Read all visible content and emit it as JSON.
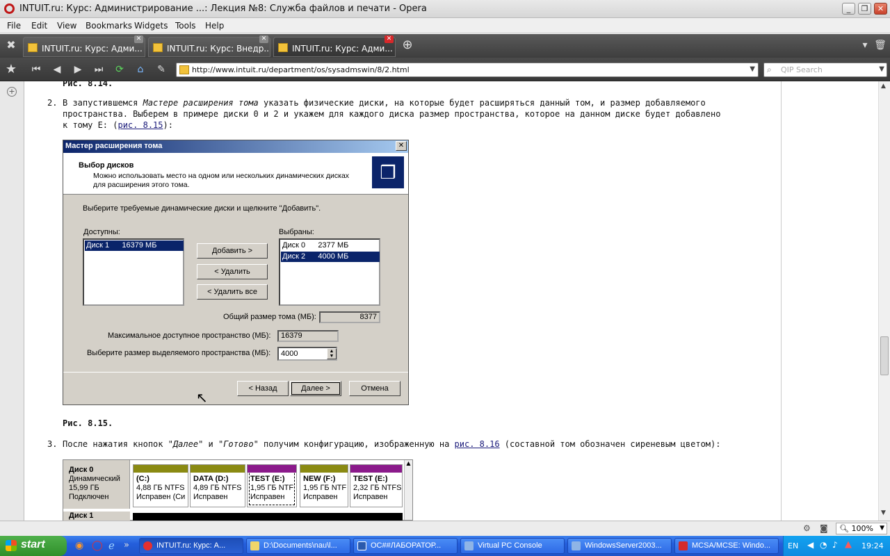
{
  "window": {
    "title": "INTUIT.ru: Курс: Администрирование ...: Лекция №8: Служба файлов и печати - Opera"
  },
  "menubar": [
    "File",
    "Edit",
    "View",
    "Bookmarks",
    "Widgets",
    "Tools",
    "Help"
  ],
  "tabs": [
    {
      "label": "INTUIT.ru: Курс: Адми..."
    },
    {
      "label": "INTUIT.ru: Курс: Внедр..."
    },
    {
      "label": "INTUIT.ru: Курс: Адми..."
    }
  ],
  "address": {
    "url": "http://www.intuit.ru/department/os/sysadmswin/8/2.html"
  },
  "search": {
    "placeholder": "QIP Search"
  },
  "article": {
    "fig_prev": "Рис. 8.14.",
    "item2": {
      "num": "2.",
      "line1_a": "В запустившемся ",
      "line1_em": "Мастере расширения тома",
      "line1_b": " указать физические диски, на которые будет расширяться данный том, и размер добавляемого",
      "line2": "пространства. Выберем в примере диски 0 и 2 и укажем для каждого диска размер пространства, которое на данном диске будет добавлено",
      "line3_a": "к тому E: (",
      "line3_link": "рис. 8.15",
      "line3_b": "):"
    },
    "fig_caption": "Рис. 8.15.",
    "item3": {
      "num": "3.",
      "a": "После нажатия кнопок \"",
      "em1": "Далее",
      "b": "\" и \"",
      "em2": "Готово",
      "c": "\" получим конфигурацию, изображенную на ",
      "link": "рис. 8.16",
      "d": " (составной том обозначен сиреневым цветом):"
    }
  },
  "dialog": {
    "title": "Мастер расширения тома",
    "heading": "Выбор дисков",
    "subheading_1": "Можно использовать место на одном или нескольких динамических дисках",
    "subheading_2": "для расширения этого тома.",
    "instruction": "Выберите требуемые динамические диски и щелкните \"Добавить\".",
    "available_label": "Доступны:",
    "available": [
      {
        "text": "Диск 1      16379 МБ",
        "selected": true
      }
    ],
    "selected_label": "Выбраны:",
    "selected": [
      {
        "text": "Диск 0      2377 МБ",
        "selected": false
      },
      {
        "text": "Диск 2      4000 МБ",
        "selected": true
      }
    ],
    "add": "Добавить >",
    "remove": "< Удалить",
    "remove_all": "< Удалить все",
    "total_label": "Общий размер тома (МБ):",
    "total_value": "8377",
    "max_label": "Максимальное доступное пространство (МБ):",
    "max_value": "16379",
    "size_label": "Выберите размер выделяемого пространства (МБ):",
    "size_value": "4000",
    "back": "< Назад",
    "next": "Далее >",
    "cancel": "Отмена"
  },
  "diskmap": {
    "disk0": {
      "name": "Диск 0",
      "type": "Динамический",
      "size": "15,99 ГБ",
      "status": "Подключен"
    },
    "disk1_name": "Диск 1",
    "partitions": [
      {
        "name": "(C:)",
        "size": "4,88 ГБ NTFS",
        "status": "Исправен (Си",
        "color": "#8a8a12"
      },
      {
        "name": "DATA  (D:)",
        "size": "4,89 ГБ NTFS",
        "status": "Исправен",
        "color": "#8a8a12"
      },
      {
        "name": "TEST  (E:)",
        "size": "1,95 ГБ NTF",
        "status": "Исправен",
        "color": "#8b1a8b"
      },
      {
        "name": "NEW  (F:)",
        "size": "1,95 ГБ NTF",
        "status": "Исправен",
        "color": "#8a8a12"
      },
      {
        "name": "TEST  (E:)",
        "size": "2,32 ГБ NTFS",
        "status": "Исправен",
        "color": "#8b1a8b"
      }
    ]
  },
  "statusbar": {
    "zoom": "100%"
  },
  "taskbar": {
    "start": "start",
    "tasks": [
      "INTUIT.ru: Курс: А...",
      "D:\\Documents\\nau\\l...",
      "ОС##ЛАБОРАТОР...",
      "Virtual PC Console",
      "WindowsServer2003...",
      "MCSA/MCSE: Windo..."
    ],
    "lang": "EN",
    "clock": "19:24"
  }
}
